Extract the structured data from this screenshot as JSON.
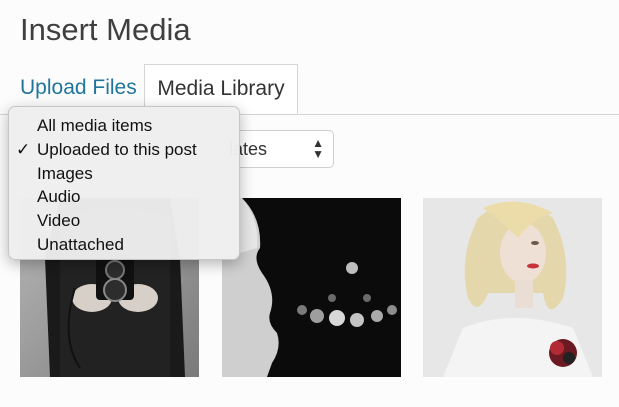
{
  "header": {
    "title": "Insert Media"
  },
  "tabs": [
    {
      "label": "Upload Files"
    },
    {
      "label": "Media Library"
    }
  ],
  "date_filter": {
    "visible_text": "lates"
  },
  "type_filter": {
    "options": [
      "All media items",
      "Uploaded to this post",
      "Images",
      "Audio",
      "Video",
      "Unattached"
    ],
    "checkmark": "✓",
    "selected": "Uploaded to this post"
  },
  "colors": {
    "link": "#21759b",
    "title": "#3f3f3f",
    "border": "#d4d4d4"
  }
}
